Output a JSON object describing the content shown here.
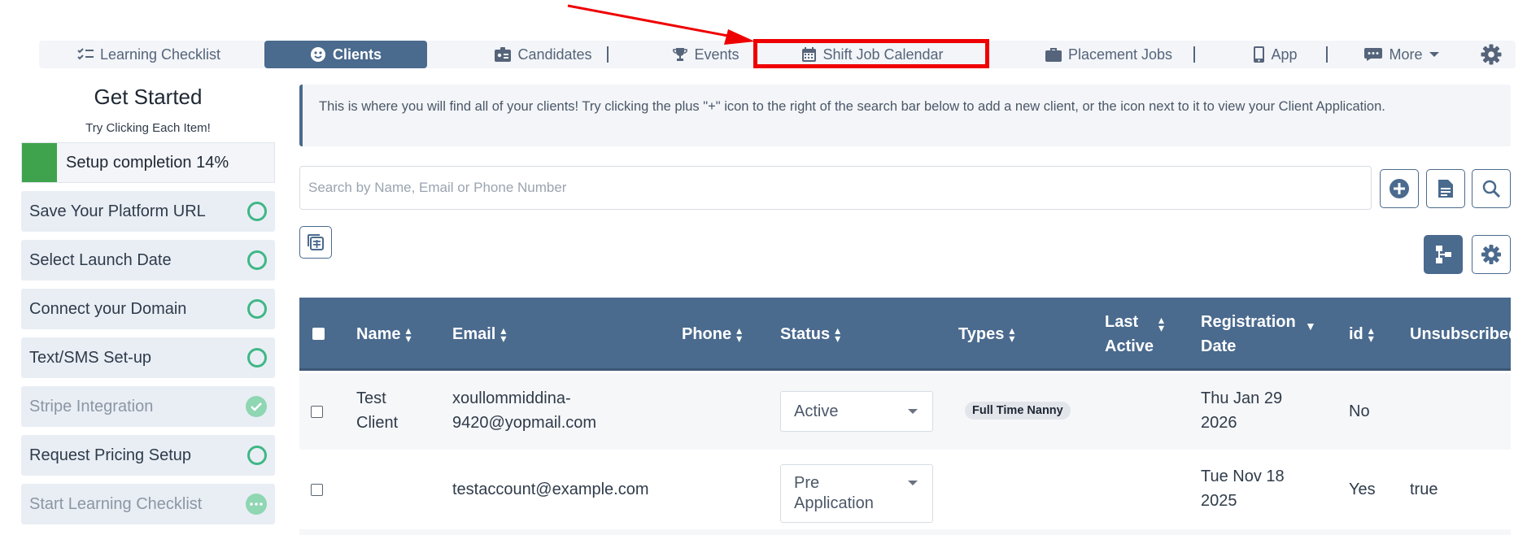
{
  "nav": {
    "items": [
      {
        "label": "Learning Checklist",
        "icon": "checklist-icon"
      },
      {
        "label": "Clients",
        "icon": "smiley-icon",
        "active": true
      },
      {
        "label": "Candidates",
        "icon": "id-card-icon"
      },
      {
        "label": "Events",
        "icon": "trophy-icon"
      },
      {
        "label": "Shift Job Calendar",
        "icon": "calendar-icon"
      },
      {
        "label": "Placement Jobs",
        "icon": "briefcase-icon"
      },
      {
        "label": "App",
        "icon": "phone-icon"
      },
      {
        "label": "More",
        "icon": "ellipsis-icon"
      }
    ]
  },
  "sidebar": {
    "title": "Get Started",
    "subtitle": "Try Clicking Each Item!",
    "progress_label": "Setup completion 14%",
    "progress_fraction": 0.14,
    "tasks": [
      {
        "label": "Save Your Platform URL",
        "state": "open"
      },
      {
        "label": "Select Launch Date",
        "state": "open"
      },
      {
        "label": "Connect your Domain",
        "state": "open"
      },
      {
        "label": "Text/SMS Set-up",
        "state": "open"
      },
      {
        "label": "Stripe Integration",
        "state": "done"
      },
      {
        "label": "Request Pricing Setup",
        "state": "open"
      },
      {
        "label": "Start Learning Checklist",
        "state": "in-progress"
      }
    ]
  },
  "info": {
    "text": "This is where you will find all of your clients! Try clicking the plus \"+\" icon to the right of the search bar below to add a new client, or the icon next to it to view your Client Application."
  },
  "search": {
    "placeholder": "Search by Name, Email or Phone Number",
    "value": ""
  },
  "table": {
    "columns": [
      {
        "label": "Name"
      },
      {
        "label": "Email"
      },
      {
        "label": "Phone"
      },
      {
        "label": "Status"
      },
      {
        "label": "Types"
      },
      {
        "label": "Last Active"
      },
      {
        "label": "Registration Date"
      },
      {
        "label": "id"
      },
      {
        "label": "Unsubscribed"
      }
    ],
    "rows": [
      {
        "name_line1": "Test",
        "name_line2": "Client",
        "email_line1": "xoullommiddina-",
        "email_line2": "9420@yopmail.com",
        "phone": "",
        "status": "Active",
        "type": "Full Time Nanny",
        "last_active": "",
        "reg_line1": "Thu Jan 29",
        "reg_line2": "2026",
        "id": "No",
        "unsubscribed": ""
      },
      {
        "name_line1": "",
        "name_line2": "",
        "email_line1": "testaccount@example.com",
        "email_line2": "",
        "phone": "",
        "status_line1": "Pre",
        "status_line2": "Application",
        "type": "",
        "last_active": "",
        "reg_line1": "Tue Nov 18",
        "reg_line2": "2025",
        "id": "Yes",
        "unsubscribed": "true"
      }
    ]
  },
  "colors": {
    "primary": "#4a6a8e",
    "highlight": "#ef0000",
    "success": "#3fb785",
    "progress": "#3fa34d"
  }
}
